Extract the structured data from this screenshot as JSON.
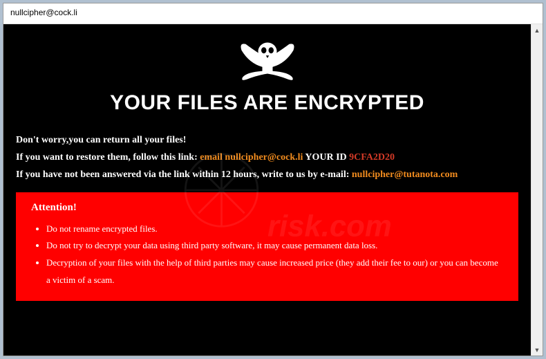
{
  "window": {
    "title": "nullcipher@cock.li"
  },
  "heading": "YOUR FILES ARE ENCRYPTED",
  "lines": {
    "l1": "Don't worry,you can return all your files!",
    "l2a": "If you want to restore them, follow this link: ",
    "l2b": "email nullcipher@cock.li",
    "l2c": "  YOUR ID ",
    "l2d": "9CFA2D20",
    "l3a": "If you have not been answered via the link within 12 hours, write to us by e-mail: ",
    "l3b": "nullcipher@tutanota.com"
  },
  "attention": {
    "title": "Attention!",
    "items": [
      "Do not rename encrypted files.",
      "Do not try to decrypt your data using third party software, it may cause permanent data loss.",
      "Decryption of your files with the help of third parties may cause increased price (they add their fee to our) or you can become a victim of a scam."
    ]
  },
  "icons": {
    "skull": "pirate-skull-swords",
    "up": "▲",
    "down": "▼"
  }
}
